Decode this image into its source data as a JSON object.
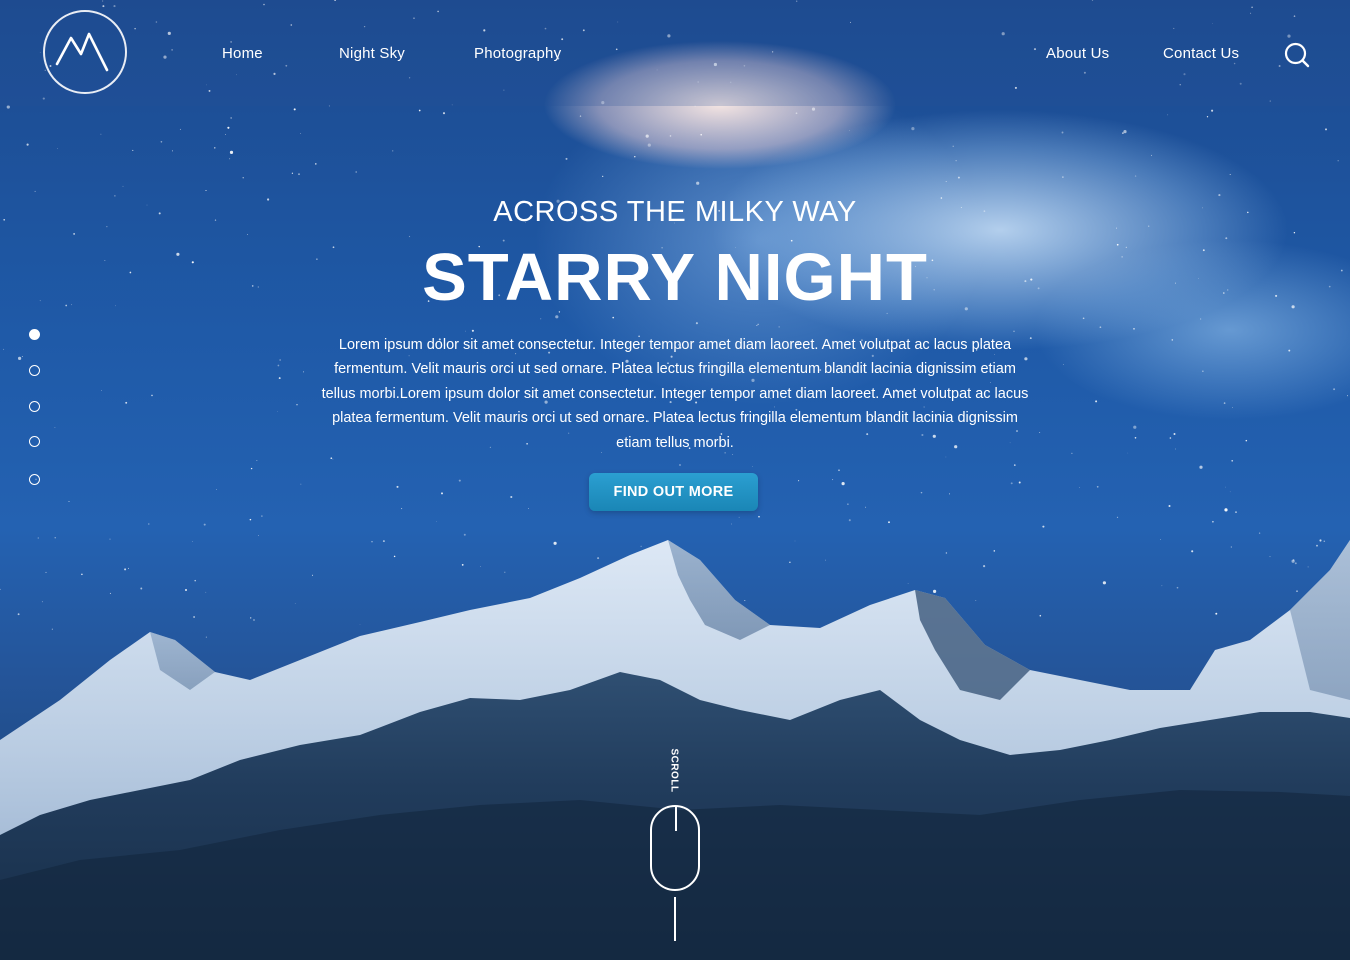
{
  "nav": {
    "links_left": [
      {
        "label": "Home"
      },
      {
        "label": "Night Sky"
      },
      {
        "label": "Photography"
      }
    ],
    "links_right": [
      {
        "label": "About Us"
      },
      {
        "label": "Contact Us"
      }
    ],
    "search_icon": "search-icon",
    "logo_icon": "mountain-logo-icon"
  },
  "pager": {
    "count": 5,
    "active_index": 0
  },
  "hero": {
    "eyebrow": "ACROSS THE MILKY WAY",
    "title": "STARRY NIGHT",
    "body": "Lorem ipsum dolor sit amet consectetur. Integer tempor amet diam laoreet. Amet volutpat ac lacus platea fermentum. Velit mauris orci ut sed ornare. Platea lectus fringilla elementum blandit lacinia dignissim etiam tellus morbi.Lorem ipsum dolor sit amet consectetur. Integer tempor amet diam laoreet. Amet volutpat ac lacus platea fermentum. Velit mauris orci ut sed ornare. Platea lectus fringilla elementum blandit lacinia dignissim etiam tellus morbi.",
    "cta_label": "FIND OUT MORE"
  },
  "scroll": {
    "label": "SCROLL",
    "icon": "mouse-icon"
  },
  "colors": {
    "cta": "#1f91c3",
    "sky": "#1f5aa8"
  }
}
